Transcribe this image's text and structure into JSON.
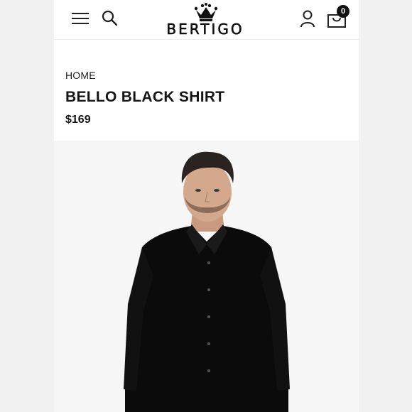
{
  "header": {
    "brand": "BERTIGO",
    "bag_count": "0",
    "icons": [
      "menu-icon",
      "search-icon",
      "account-icon",
      "shopping-bag-icon"
    ]
  },
  "breadcrumb": "HOME",
  "product": {
    "title": "BELLO BLACK SHIRT",
    "price": "$169"
  },
  "colors": {
    "text": "#151515",
    "photo_bg": "#f6f6f6",
    "shirt": "#0b0b0b"
  }
}
